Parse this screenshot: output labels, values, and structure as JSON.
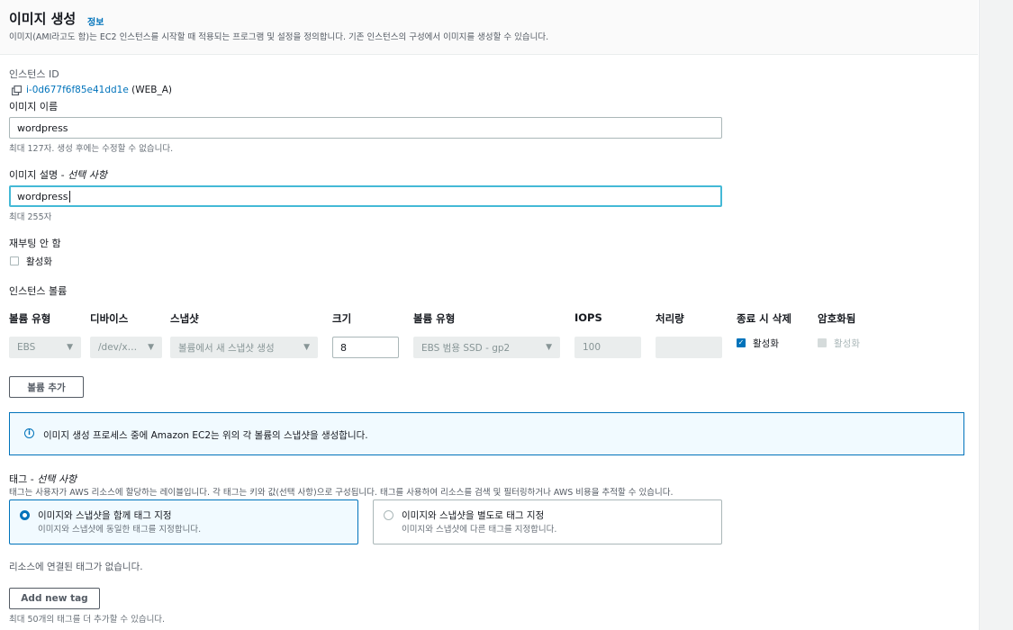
{
  "header": {
    "title": "이미지 생성",
    "info_link": "정보",
    "description": "이미지(AMI라고도 함)는 EC2 인스턴스를 시작할 때 적용되는 프로그램 및 설정을 정의합니다. 기존 인스턴스의 구성에서 이미지를 생성할 수 있습니다."
  },
  "instance": {
    "label": "인스턴스 ID",
    "id": "i-0d677f6f85e41dd1e",
    "name": "(WEB_A)"
  },
  "image_name": {
    "label": "이미지 이름",
    "value": "wordpress",
    "hint": "최대 127자. 생성 후에는 수정할 수 없습니다."
  },
  "image_description": {
    "label": "이미지 설명 - ",
    "label_optional": "선택 사항",
    "value": "wordpress",
    "hint": "최대 255자"
  },
  "no_reboot": {
    "label": "재부팅 안 함",
    "checkbox_label": "활성화"
  },
  "volumes": {
    "section_label": "인스턴스 볼륨",
    "headers": {
      "volume_type": "볼륨 유형",
      "device": "디바이스",
      "snapshot": "스냅샷",
      "size": "크기",
      "ebs_type": "볼륨 유형",
      "iops": "IOPS",
      "throughput": "처리량",
      "delete_on_termination": "종료 시 삭제",
      "encrypted": "암호화됨"
    },
    "row": {
      "volume_type": "EBS",
      "device": "/dev/x…",
      "snapshot": "볼륨에서 새 스냅샷 생성",
      "size": "8",
      "ebs_type": "EBS 범용 SSD - gp2",
      "iops": "100",
      "throughput": "",
      "delete_on_termination_label": "활성화",
      "delete_on_termination_checked": true,
      "encrypted_label": "활성화",
      "encrypted_checked": false
    },
    "add_button": "볼륨 추가"
  },
  "info_alert": {
    "text": "이미지 생성 프로세스 중에 Amazon EC2는 위의 각 볼륨의 스냅샷을 생성합니다."
  },
  "tags": {
    "label": "태그 - ",
    "label_optional": "선택 사항",
    "description": "태그는 사용자가 AWS 리소스에 할당하는 레이블입니다. 각 태그는 키와 값(선택 사항)으로 구성됩니다. 태그를 사용하여 리소스를 검색 및 필터링하거나 AWS 비용을 추적할 수 있습니다.",
    "options": [
      {
        "title": "이미지와 스냅샷을 함께 태그 지정",
        "desc": "이미지와 스냅샷에 동일한 태그를 지정합니다.",
        "selected": true
      },
      {
        "title": "이미지와 스냅샷을 별도로 태그 지정",
        "desc": "이미지와 스냅샷에 다른 태그를 지정합니다.",
        "selected": false
      }
    ],
    "empty_text": "리소스에 연결된 태그가 없습니다.",
    "add_button": "Add new tag",
    "hint": "최대 50개의 태그를 더 추가할 수 있습니다."
  },
  "colors": {
    "link": "#0073bb",
    "focus": "#44b9d6",
    "info_bg": "#f1faff"
  }
}
